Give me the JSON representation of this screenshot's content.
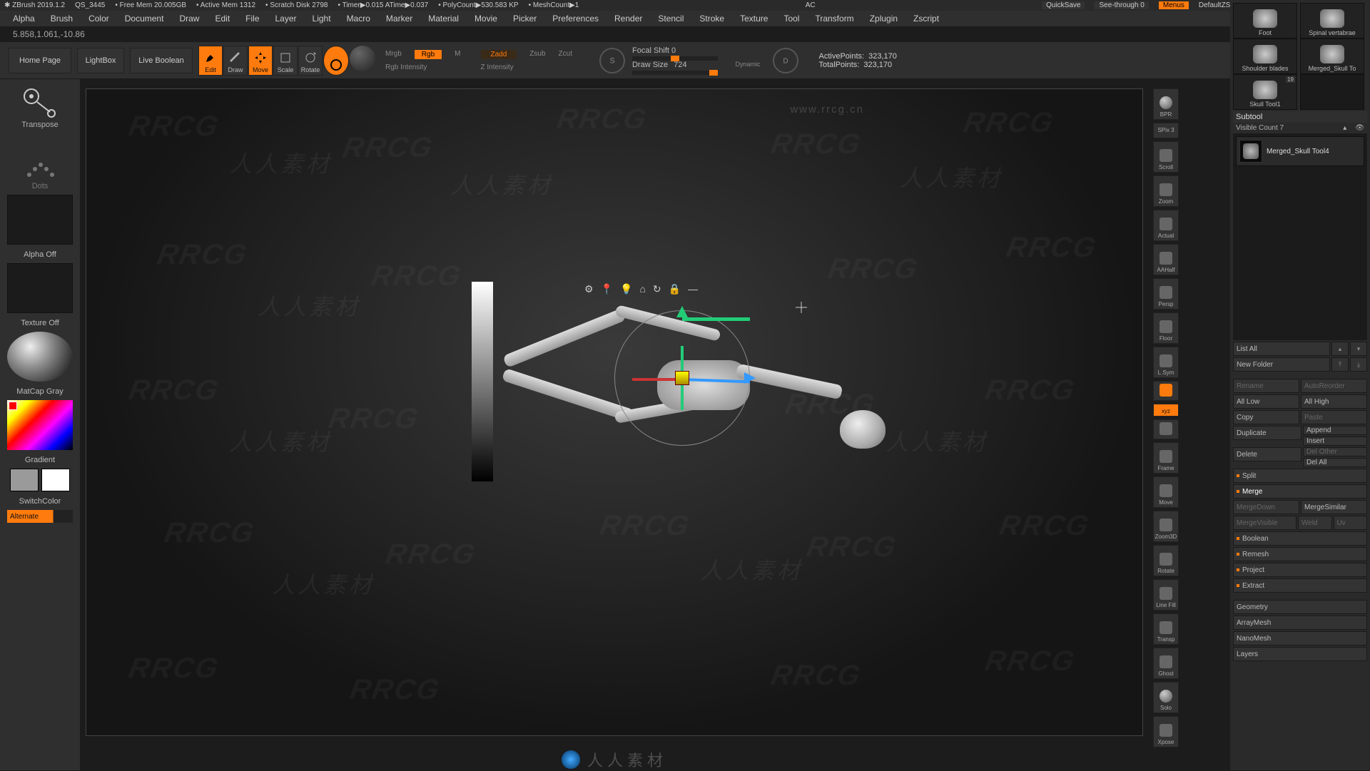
{
  "titlebar": {
    "app": "ZBrush 2019.1.2",
    "doc": "QS_3445",
    "freemem": "Free Mem 20.005GB",
    "activemem": "Active Mem 1312",
    "scratch": "Scratch Disk 2798",
    "timer": "Timer▶0.015 ATime▶0.037",
    "polycount": "PolyCount▶530.583 KP",
    "meshcount": "MeshCount▶1",
    "ac": "AC",
    "quicksave": "QuickSave",
    "seethrough": "See-through  0",
    "menus": "Menus",
    "default": "DefaultZScript"
  },
  "menubar": [
    "Alpha",
    "Brush",
    "Color",
    "Document",
    "Draw",
    "Edit",
    "File",
    "Layer",
    "Light",
    "Macro",
    "Marker",
    "Material",
    "Movie",
    "Picker",
    "Preferences",
    "Render",
    "Stencil",
    "Stroke",
    "Texture",
    "Tool",
    "Transform",
    "Zplugin",
    "Zscript"
  ],
  "coords": "5.858,1.061,-10.86",
  "toolbar": {
    "home": "Home Page",
    "lightbox": "LightBox",
    "liveboolean": "Live Boolean",
    "edit": "Edit",
    "draw": "Draw",
    "move": "Move",
    "scale": "Scale",
    "rotate": "Rotate",
    "mrgb": "Mrgb",
    "rgb": "Rgb",
    "m": "M",
    "rgbint": "Rgb Intensity",
    "zadd": "Zadd",
    "zsub": "Zsub",
    "zcut": "Zcut",
    "zint": "Z Intensity",
    "focal": "Focal Shift 0",
    "drawsizelbl": "Draw Size",
    "drawsize": "724",
    "dynamic": "Dynamic",
    "activepts_label": "ActivePoints:",
    "activepts": "323,170",
    "totalpts_label": "TotalPoints:",
    "totalpts": "323,170"
  },
  "left": {
    "transpose": "Transpose",
    "dots": "Dots",
    "alphaoff": "Alpha Off",
    "textureoff": "Texture Off",
    "matcap": "MatCap Gray",
    "gradient": "Gradient",
    "switchcolor": "SwitchColor",
    "alternate": "Alternate"
  },
  "rstrip": {
    "bpr": "BPR",
    "spix": "SPix 3",
    "scroll": "Scroll",
    "zoom": "Zoom",
    "actual": "Actual",
    "aahalf": "AAHalf",
    "persp": "Persp",
    "floor": "Floor",
    "lsym": "L.Sym",
    "lock": "",
    "xyz": "xyz",
    "hand": "",
    "frame": "Frame",
    "move": "Move",
    "zoom3d": "Zoom3D",
    "rotate": "Rotate",
    "linefill": "Line Fill",
    "transp": "Transp",
    "ghost": "Ghost",
    "solo": "Solo",
    "xpose": "Xpose"
  },
  "tool": {
    "thumbs": [
      {
        "label": "Foot"
      },
      {
        "label": "Spinal vertabrae"
      },
      {
        "label": "Shoulder blades"
      },
      {
        "label": "Merged_Skull To"
      },
      {
        "label": "Skull Tool1",
        "badge": "19"
      }
    ],
    "subtool_head": "Subtool",
    "visible": "Visible Count 7",
    "entry": "Merged_Skull Tool4",
    "buttons": {
      "listall": "List All",
      "newfolder": "New Folder",
      "rename": "Rename",
      "autoreorder": "AutoReorder",
      "alllow": "All Low",
      "allhigh": "All High",
      "copy": "Copy",
      "paste": "Paste",
      "duplicate": "Duplicate",
      "append": "Append",
      "insert": "Insert",
      "delete": "Delete",
      "delother": "Del Other",
      "delall": "Del All",
      "split": "Split",
      "merge": "Merge",
      "mergedown": "MergeDown",
      "mergesimilar": "MergeSimilar",
      "mergevisible": "MergeVisible",
      "weld": "Weld",
      "uv": "Uv",
      "boolean": "Boolean",
      "remesh": "Remesh",
      "project": "Project",
      "extract": "Extract",
      "geometry": "Geometry",
      "arraymesh": "ArrayMesh",
      "nanomesh": "NanoMesh",
      "layers": "Layers"
    }
  },
  "viewport": {
    "watermark": "RRCG",
    "watermark_cn": "人人素材",
    "url": "www.rrcg.cn"
  }
}
